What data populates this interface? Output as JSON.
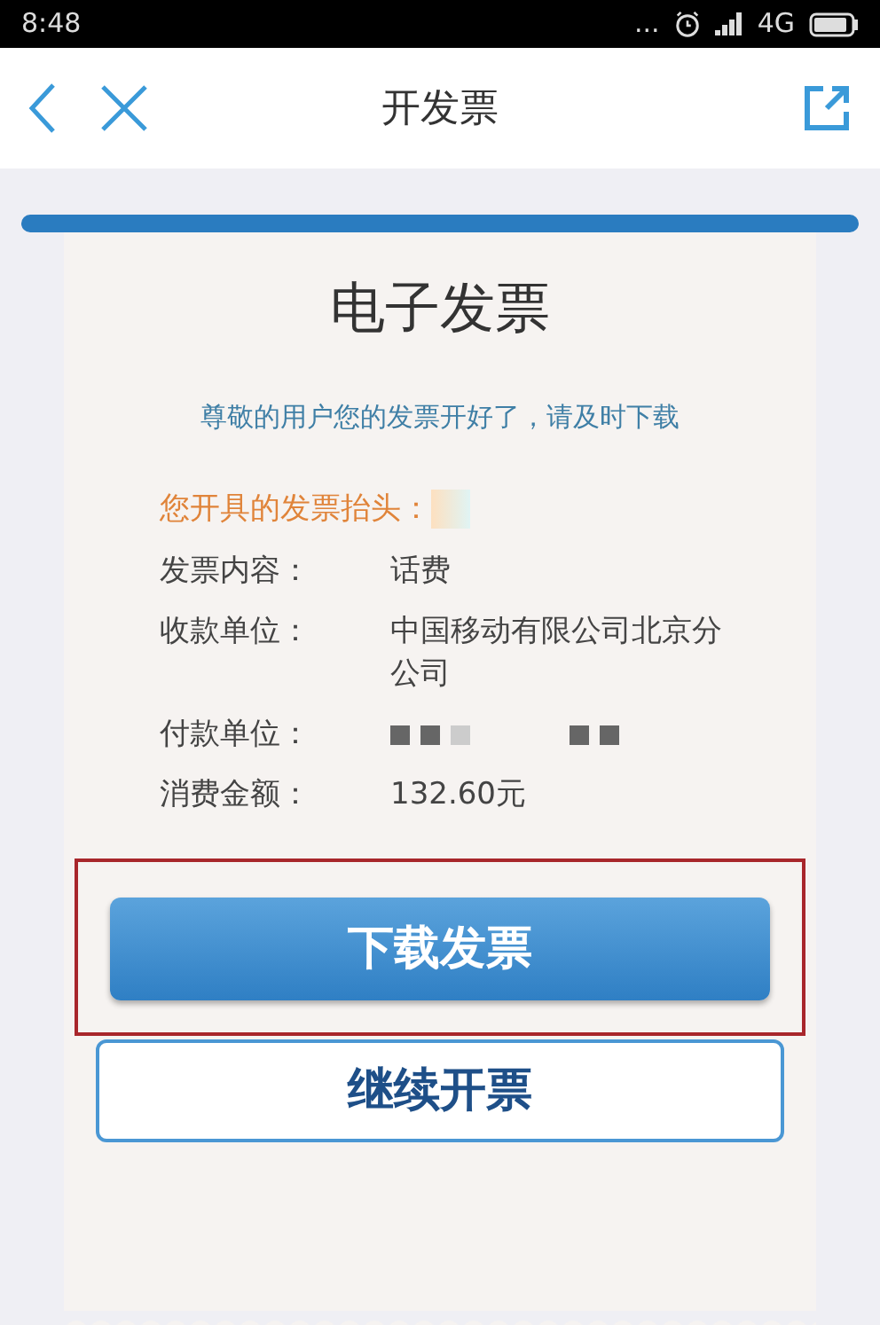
{
  "status_bar": {
    "time": "8:48",
    "dots": "...",
    "network": "4G"
  },
  "nav": {
    "title": "开发票"
  },
  "invoice": {
    "title": "电子发票",
    "message": "尊敬的用户您的发票开好了，请及时下载",
    "header_label": "您开具的发票抬头：",
    "fields": [
      {
        "label": "发票内容：",
        "value": "话费"
      },
      {
        "label": "收款单位：",
        "value": "中国移动有限公司北京分公司"
      },
      {
        "label": "付款单位：",
        "kind": "redacted"
      },
      {
        "label": "消费金额：",
        "value": "132.60元"
      }
    ]
  },
  "buttons": [
    {
      "label": "下载发票",
      "kind": "primary",
      "highlighted": true
    },
    {
      "label": "继续开票",
      "kind": "outline",
      "highlighted": false
    }
  ]
}
